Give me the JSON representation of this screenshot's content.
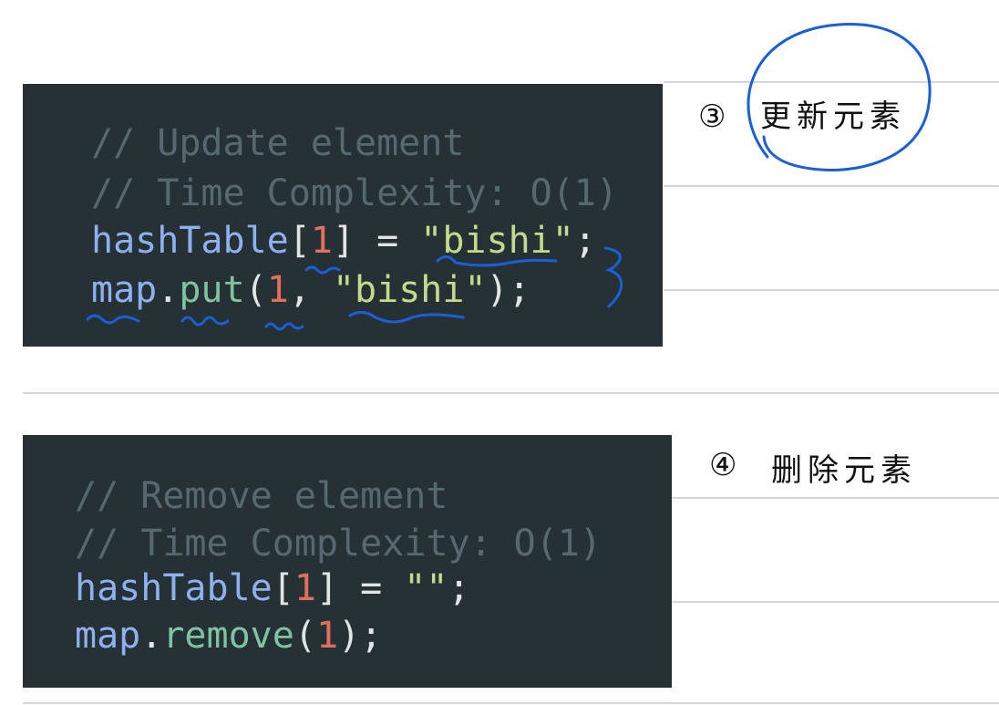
{
  "block_update": {
    "comment1": "// Update element",
    "comment2": "// Time Complexity: O(1)",
    "l3": {
      "var": "hashTable",
      "open": "[",
      "num": "1",
      "close": "] = ",
      "str": "\"bishi\"",
      "end": ";"
    },
    "l4": {
      "obj": "map",
      "dot": ".",
      "method": "put",
      "open": "(",
      "num": "1",
      "comma": ", ",
      "str": "\"bishi\"",
      "end": ");"
    }
  },
  "block_remove": {
    "comment1": "// Remove element",
    "comment2": "// Time Complexity: O(1)",
    "l3": {
      "var": "hashTable",
      "open": "[",
      "num": "1",
      "close": "] = ",
      "str": "\"\"",
      "end": ";"
    },
    "l4": {
      "obj": "map",
      "dot": ".",
      "method": "remove",
      "open": "(",
      "num": "1",
      "end": ");"
    }
  },
  "annotations": {
    "note3_number": "③",
    "note3_text": "更新元素",
    "note4_number": "④",
    "note4_text": "删除元素"
  },
  "colors": {
    "code_bg": "#263136",
    "ink_blue": "#1a5fd6",
    "ink_black": "#111111"
  }
}
